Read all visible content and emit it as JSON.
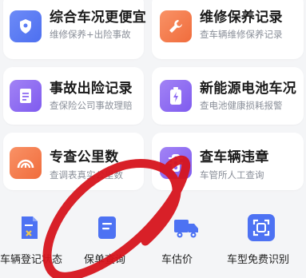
{
  "cards": [
    {
      "title": "综合车况更便宜",
      "subtitle": "维修保养+出险事故",
      "icon": "shield-icon",
      "color": "#5b7cf5"
    },
    {
      "title": "维修保养记录",
      "subtitle": "查车辆维修保养记录",
      "icon": "wrench-icon",
      "color": "#f47b4a"
    },
    {
      "title": "事故出险记录",
      "subtitle": "查保险公司事故理赔",
      "icon": "document-icon",
      "color": "#8f6cf2"
    },
    {
      "title": "新能源电池车况",
      "subtitle": "查电池健康损耗报警",
      "icon": "battery-icon",
      "color": "#8f6cf2"
    },
    {
      "title": "专查公里数",
      "subtitle": "查调表真实公里数",
      "icon": "gauge-icon",
      "color": "#f47b4a"
    },
    {
      "title": "查车辆违章",
      "subtitle": "车管所人工查询",
      "icon": "traffic-light-icon",
      "color": "#8f6cf2"
    }
  ],
  "services": [
    {
      "label": "车辆登记状态",
      "icon": "registration-doc-icon"
    },
    {
      "label": "保单查询",
      "icon": "policy-doc-icon"
    },
    {
      "label": "车估价",
      "icon": "truck-icon"
    },
    {
      "label": "车型免费识别",
      "icon": "scan-icon"
    }
  ],
  "colors": {
    "blue": "#4d72f3",
    "annotation_red": "#d6141c"
  }
}
